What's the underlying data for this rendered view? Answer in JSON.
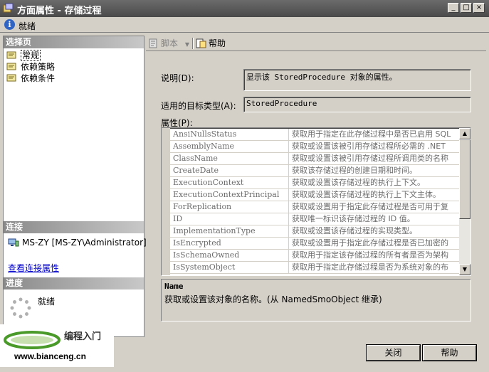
{
  "window": {
    "title": "方面属性 - 存储过程",
    "buttons": [
      "_",
      "□",
      "×"
    ]
  },
  "status": {
    "text": "就绪"
  },
  "left": {
    "select_page_header": "选择页",
    "nav_items": [
      {
        "label": "常规",
        "active": true
      },
      {
        "label": "依赖策略",
        "active": false
      },
      {
        "label": "依赖条件",
        "active": false
      }
    ],
    "connection_header": "连接",
    "connection_text": "MS-ZY [MS-ZY\\Administrator]",
    "view_connection_link": "查看连接属性",
    "progress_header": "进度",
    "progress_text": "就绪"
  },
  "toolbar": {
    "script_label": "脚本",
    "help_label": "帮助"
  },
  "form": {
    "description_label": "说明(D):",
    "description_value": "显示该 StoredProcedure 对象的属性。",
    "target_type_label": "适用的目标类型(A):",
    "target_type_value": "StoredProcedure",
    "properties_label": "属性(P):"
  },
  "properties": [
    {
      "name": "AnsiNullsStatus",
      "desc": "获取用于指定在此存储过程中是否已启用 SQL"
    },
    {
      "name": "AssemblyName",
      "desc": "获取或设置该被引用存储过程所必需的 .NET"
    },
    {
      "name": "ClassName",
      "desc": "获取或设置该被引用存储过程所调用类的名称"
    },
    {
      "name": "CreateDate",
      "desc": "获取该存储过程的创建日期和时间。"
    },
    {
      "name": "ExecutionContext",
      "desc": "获取或设置该存储过程的执行上下文。"
    },
    {
      "name": "ExecutionContextPrincipal",
      "desc": "获取或设置该存储过程的执行上下文主体。"
    },
    {
      "name": "ForReplication",
      "desc": "获取或设置用于指定此存储过程是否可用于复"
    },
    {
      "name": "ID",
      "desc": "获取唯一标识该存储过程的 ID 值。"
    },
    {
      "name": "ImplementationType",
      "desc": "获取或设置该存储过程的实现类型。"
    },
    {
      "name": "IsEncrypted",
      "desc": "获取或设置用于指定此存储过程是否已加密的"
    },
    {
      "name": "IsSchemaOwned",
      "desc": "获取用于指定该存储过程的所有者是否为架构"
    },
    {
      "name": "IsSystemObject",
      "desc": "获取用于指定此存储过程是否为系统对象的布"
    }
  ],
  "description_panel": {
    "title": "Name",
    "body": "获取或设置该对象的名称。(从 NamedSmoObject 继承)"
  },
  "dialog_buttons": {
    "close_label": "关闭",
    "help_label": "帮助"
  },
  "watermark": {
    "title": "编程入门",
    "url": "www.bianceng.cn"
  }
}
